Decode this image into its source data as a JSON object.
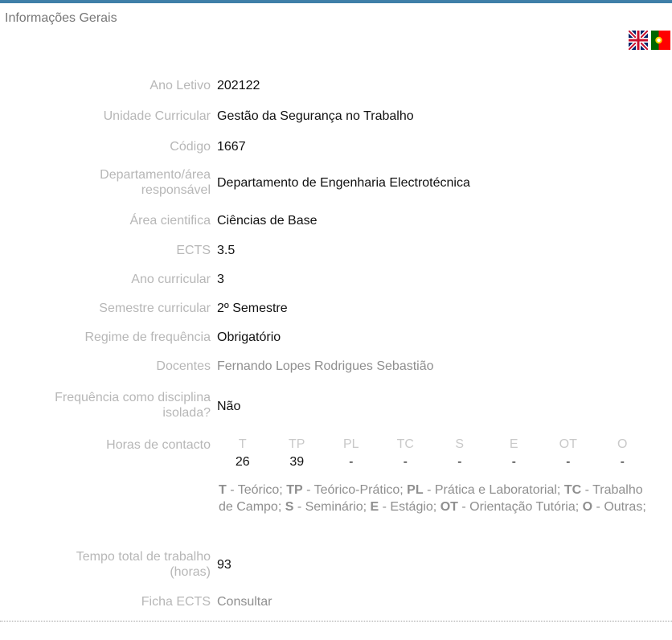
{
  "section_title": "Informações Gerais",
  "flags": {
    "en": "uk-flag-icon",
    "pt": "portugal-flag-icon"
  },
  "fields": {
    "ano_letivo": {
      "label": "Ano Letivo",
      "value": "202122"
    },
    "unidade": {
      "label": "Unidade Curricular",
      "value": "Gestão da Segurança no Trabalho"
    },
    "codigo": {
      "label": "Código",
      "value": "1667"
    },
    "departamento": {
      "label_1": "Departamento/área",
      "label_2": "responsável",
      "value": "Departamento de Engenharia Electrotécnica"
    },
    "area": {
      "label": "Área cientifica",
      "value": "Ciências de Base"
    },
    "ects": {
      "label": "ECTS",
      "value": "3.5"
    },
    "ano_curricular": {
      "label": "Ano curricular",
      "value": "3"
    },
    "semestre": {
      "label": "Semestre curricular",
      "value": "2º Semestre"
    },
    "regime": {
      "label": "Regime de frequência",
      "value": "Obrigatório"
    },
    "docentes": {
      "label": "Docentes",
      "value": "Fernando Lopes Rodrigues Sebastião"
    },
    "frequencia": {
      "label_1": "Frequência como disciplina",
      "label_2": "isolada?",
      "value": "Não"
    },
    "horas": {
      "label": "Horas de contacto"
    },
    "tempo": {
      "label_1": "Tempo total de trabalho",
      "label_2": "(horas)",
      "value": "93"
    },
    "ficha": {
      "label": "Ficha ECTS",
      "value": "Consultar"
    }
  },
  "hours": {
    "headers": [
      "T",
      "TP",
      "PL",
      "TC",
      "S",
      "E",
      "OT",
      "O"
    ],
    "values": [
      "26",
      "39",
      "-",
      "-",
      "-",
      "-",
      "-",
      "-"
    ],
    "legend": [
      {
        "abbr": "T",
        "text": " - Teórico; "
      },
      {
        "abbr": "TP",
        "text": " - Teórico-Prático; "
      },
      {
        "abbr": "PL",
        "text": " - Prática e Laboratorial; "
      },
      {
        "abbr": "TC",
        "text": " - Trabalho de Campo; "
      },
      {
        "abbr": "S",
        "text": " - Seminário; "
      },
      {
        "abbr": "E",
        "text": " - Estágio; "
      },
      {
        "abbr": "OT",
        "text": " - Orientação Tutória; "
      },
      {
        "abbr": "O",
        "text": " - Outras;"
      }
    ]
  }
}
